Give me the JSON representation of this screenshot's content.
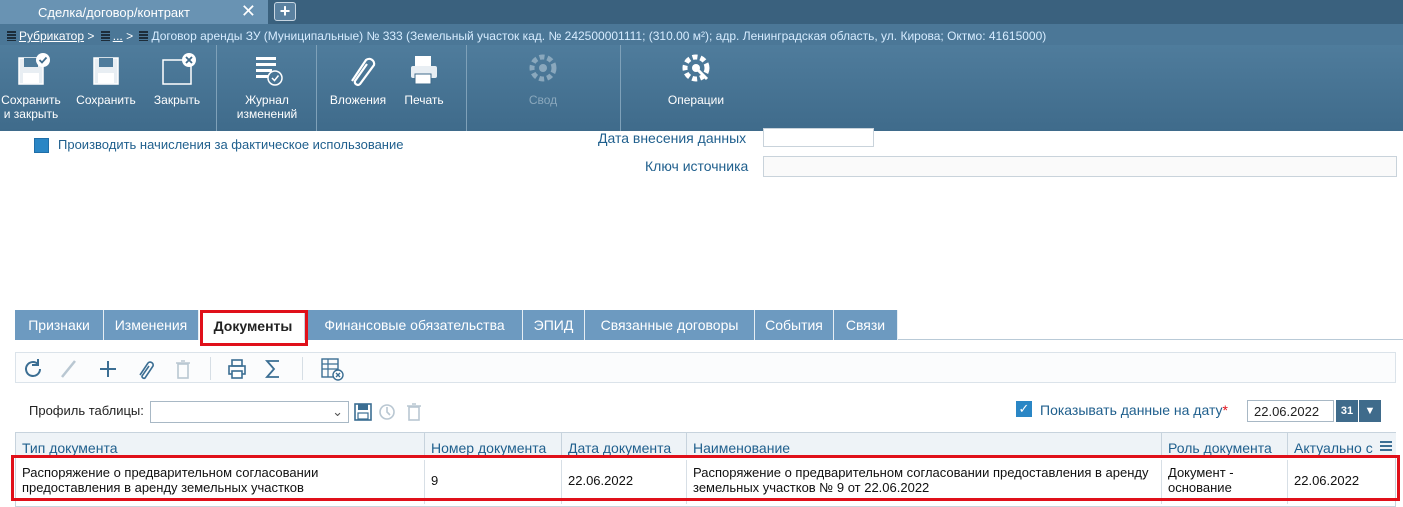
{
  "window_tab": {
    "title": "Сделка/договор/контракт",
    "close_glyph": "✕",
    "new_tab_glyph": "+"
  },
  "breadcrumb": {
    "rubricator": "Рубрикатор",
    "separator": ">",
    "ellipsis": "...",
    "document": "Договор аренды ЗУ (Муниципальные) № 333 (Земельный участок кад. № 242500001111; (310.00 м²); адр. Ленинградская область, ул. Кирова; Октмо: 41615000)"
  },
  "ribbon": {
    "save_close": "Сохранить и закрыть",
    "save": "Сохранить",
    "close": "Закрыть",
    "journal": "Журнал изменений",
    "attachments": "Вложения",
    "print": "Печать",
    "summary": "Свод",
    "operations": "Операции"
  },
  "form": {
    "fact_usage_label": "Производить начисления за фактическое использование",
    "date_entry_label": "Дата внесения данных",
    "date_entry_value": "",
    "source_key_label": "Ключ источника",
    "source_key_value": ""
  },
  "tabs": [
    "Признаки",
    "Изменения",
    "Документы",
    "Финансовые обязательства",
    "ЭПИД",
    "Связанные договоры",
    "События",
    "Связи"
  ],
  "active_tab": "Документы",
  "grid_toolbar": {
    "icons": [
      "refresh-icon",
      "edit-icon",
      "add-icon",
      "attach-icon",
      "delete-icon",
      "print-icon",
      "sum-icon",
      "table-settings-icon"
    ]
  },
  "profile": {
    "label": "Профиль таблицы:",
    "value": "",
    "show_data_label": "Показывать данные на дату",
    "required_mark": "*",
    "date_value": "22.06.2022",
    "calendar_label": "31",
    "dropdown_glyph": "▼"
  },
  "table": {
    "columns": [
      "Тип документа",
      "Номер документа",
      "Дата документа",
      "Наименование",
      "Роль документа",
      "Актуально с"
    ],
    "rows": [
      {
        "type": "Распоряжение о предварительном согласовании предоставления в аренду земельных участков",
        "number": "9",
        "date": "22.06.2022",
        "name": "Распоряжение о предварительном согласовании предоставления в аренду земельных участков № 9 от 22.06.2022",
        "role": "Документ - основание",
        "actual_from": "22.06.2022"
      }
    ]
  },
  "colors": {
    "brand": "#3f6b8b",
    "tab_bg": "#6d9ac0",
    "link": "#1f5f8d",
    "highlight": "#e0101a"
  }
}
